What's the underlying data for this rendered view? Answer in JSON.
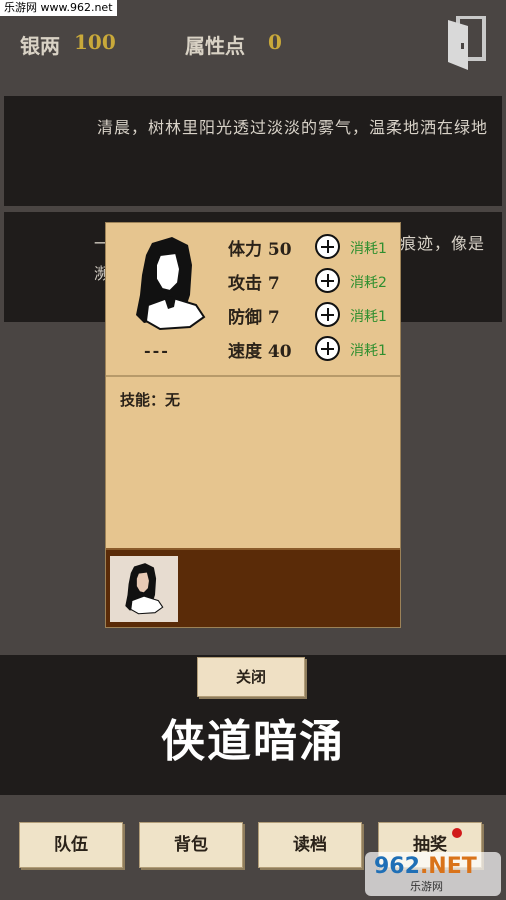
{
  "watermark_top": "乐游网 www.962.net",
  "stats": {
    "silver_label": "银两",
    "silver_value": "100",
    "points_label": "属性点",
    "points_value": "0"
  },
  "story": {
    "panel1": "清晨，树林里阳光透过淡淡的雾气，温柔地洒在绿地",
    "panel2_left_fragment": "一",
    "panel2_left_fragment2": "濒",
    "panel2_right_fragment": "痕迹，像是"
  },
  "dialog": {
    "name": "---",
    "attributes": [
      {
        "label": "体力 50",
        "cost": "消耗1"
      },
      {
        "label": "攻击 7",
        "cost": "消耗2"
      },
      {
        "label": "防御 7",
        "cost": "消耗1"
      },
      {
        "label": "速度 40",
        "cost": "消耗1"
      }
    ],
    "skills": "技能：无",
    "close_label": "关闭"
  },
  "game_title": "侠道暗涌",
  "nav": [
    "队伍",
    "背包",
    "读档",
    "抽奖"
  ],
  "watermark_br": {
    "main_left": "962",
    "main_right": ".NET",
    "sub": "乐游网"
  },
  "colors": {
    "accent_gold": "#c9a93a",
    "cost_green": "#2f8f2f",
    "dialog_bg": "#e6c58f",
    "team_bar": "#5a2b08",
    "notify_red": "#d11a1a"
  }
}
